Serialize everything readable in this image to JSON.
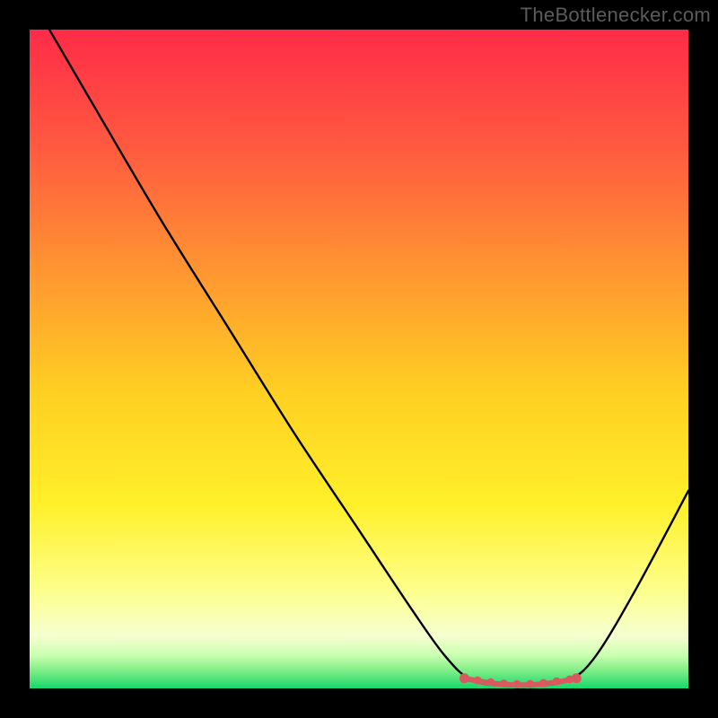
{
  "watermark": "TheBottlenecker.com",
  "colors": {
    "frame": "#000000",
    "curve": "#000000",
    "optimal_marker": "#d85a5f",
    "gradient_top": "#ff2b48",
    "gradient_mid_upper": "#ff7a3a",
    "gradient_mid": "#ffd024",
    "gradient_mid_lower": "#fff79a",
    "gradient_low": "#f4ffd4",
    "gradient_bottom": "#17d86b"
  },
  "chart_data": {
    "type": "line",
    "title": "",
    "xlabel": "",
    "ylabel": "",
    "xlim": [
      0,
      100
    ],
    "ylim": [
      0,
      100
    ],
    "curve": [
      {
        "x": 3,
        "y": 100
      },
      {
        "x": 10,
        "y": 88
      },
      {
        "x": 20,
        "y": 71
      },
      {
        "x": 30,
        "y": 55
      },
      {
        "x": 40,
        "y": 39
      },
      {
        "x": 50,
        "y": 24
      },
      {
        "x": 58,
        "y": 12
      },
      {
        "x": 63,
        "y": 5
      },
      {
        "x": 67,
        "y": 1.3
      },
      {
        "x": 72,
        "y": 0.4
      },
      {
        "x": 77,
        "y": 0.4
      },
      {
        "x": 82,
        "y": 1.3
      },
      {
        "x": 86,
        "y": 5
      },
      {
        "x": 92,
        "y": 15
      },
      {
        "x": 100,
        "y": 30
      }
    ],
    "optimal_range": {
      "x_start": 66,
      "x_end": 83,
      "y": 1.4
    },
    "optimal_markers_x": [
      66,
      68,
      70,
      72,
      74,
      76,
      78,
      80,
      82,
      83
    ]
  }
}
